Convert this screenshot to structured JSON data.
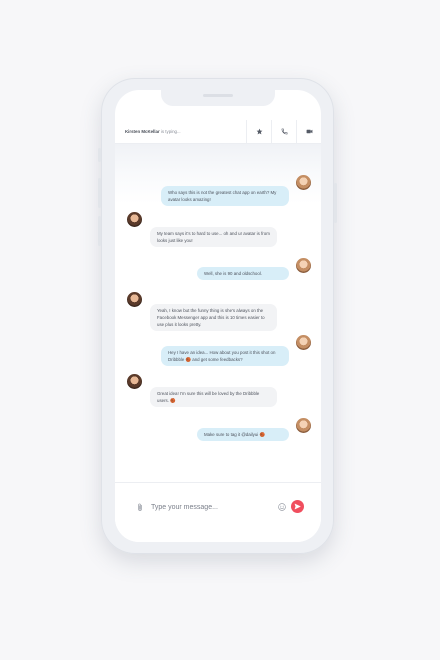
{
  "header": {
    "contact_name": "Kirsten McKellar",
    "status": "is typing..."
  },
  "icons": {
    "star": "star-icon",
    "phone": "phone-icon",
    "video": "video-camera-icon",
    "attach": "paperclip-icon",
    "emoji": "smiley-icon",
    "send": "send-icon"
  },
  "messages": [
    {
      "from": "me",
      "text": "Who says this is not the greatest chat app on earth? My avatar looks amazing!"
    },
    {
      "from": "them",
      "text": "My team says it's to hard to use... oh and ur avatar is from looks just like you!"
    },
    {
      "from": "me",
      "text": "Well, she is 90 and oldschool."
    },
    {
      "from": "them",
      "text": "Yeah, I know but the funny thing is she's always on the Facebook Messenger app and this is 10 times easier to use plus it looks pretty."
    },
    {
      "from": "me",
      "text": "Hey I have an idea... How about you post it this shot on Dribbble 🏀 and get some feedbacks?"
    },
    {
      "from": "them",
      "text": "Great idea! I'm sure this will be loved by the Dribbble users. 🏀"
    },
    {
      "from": "me",
      "text": "Make sure to tag it @dailyui 🏀"
    }
  ],
  "composer": {
    "placeholder": "Type your message..."
  },
  "colors": {
    "outgoing_bubble": "#d8eef8",
    "incoming_bubble": "#f2f3f5",
    "send_button": "#f04e5e",
    "background": "#f7f7f9"
  }
}
